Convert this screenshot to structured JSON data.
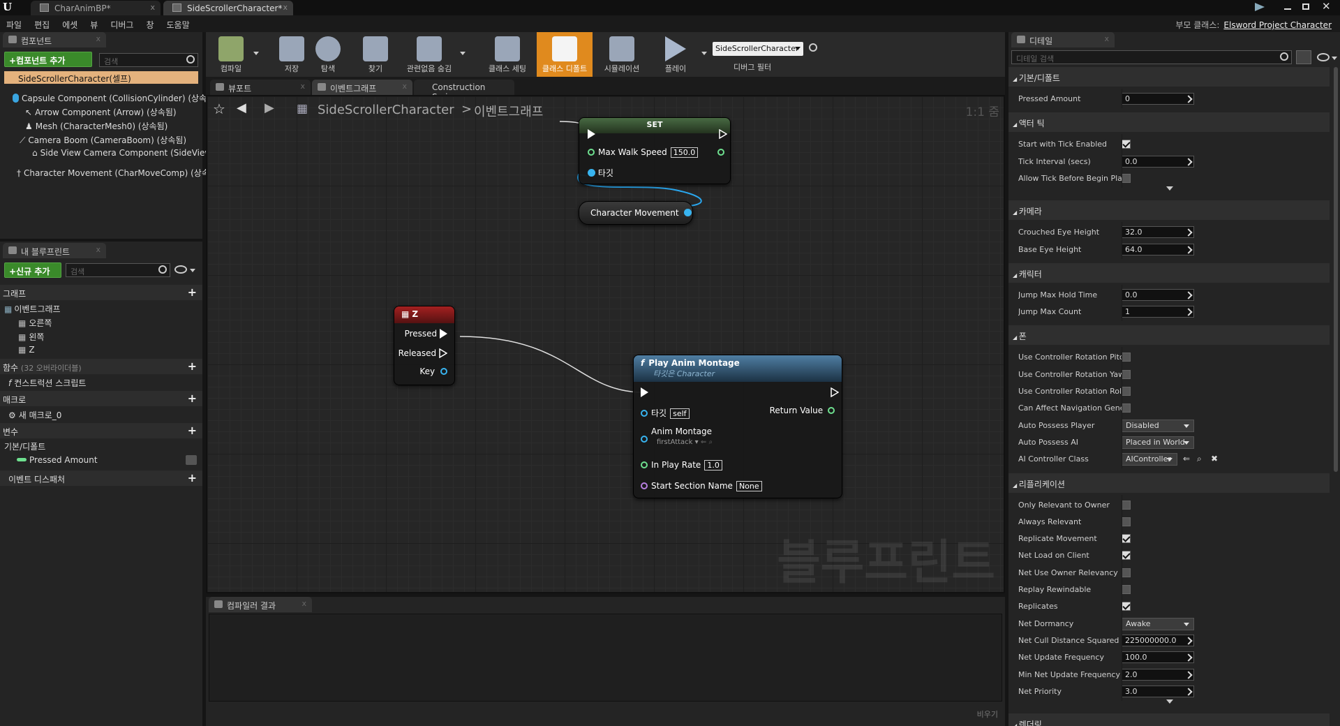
{
  "tabs": [
    {
      "label": "CharAnimBP*",
      "close": "x"
    },
    {
      "label": "SideScrollerCharacter*",
      "close": "x"
    }
  ],
  "menu": [
    "파일",
    "편집",
    "에셋",
    "뷰",
    "디버그",
    "창",
    "도움말"
  ],
  "parent_class": {
    "label": "부모 클래스:",
    "value": "Elsword Project Character"
  },
  "components": {
    "tab": "컴포넌트",
    "add_button": "+컴포넌트 추가",
    "search_placeholder": "검색",
    "root": "SideScrollerCharacter(셀프)",
    "items": [
      "Capsule Component (CollisionCylinder) (상속",
      "Arrow Component (Arrow) (상속됨)",
      "Mesh (CharacterMesh0) (상속됨)",
      "Camera Boom (CameraBoom) (상속됨)",
      "Side View Camera Component (SideView",
      "Character Movement (CharMoveComp) (상속"
    ]
  },
  "myblueprint": {
    "tab": "내 블루프린트",
    "add_button": "+신규 추가",
    "search_placeholder": "검색",
    "graph_section": "그래프",
    "eventgraph": "이벤트그래프",
    "events": [
      "오른쪽",
      "왼쪽",
      "Z"
    ],
    "functions_section": "함수",
    "functions_note": "(32 오버라이더블)",
    "construction_script": "컨스트럭션 스크립트",
    "macros_section": "매크로",
    "macro_item": "새 매크로_0",
    "variables_section": "변수",
    "default_section": "기본/디폴트",
    "pressed_amount": "Pressed Amount",
    "dispatcher_section": "이벤트 디스패처"
  },
  "toolbar": {
    "compile": "컴파일",
    "save": "저장",
    "browse": "탐색",
    "find": "찾기",
    "hide_unrelated": "관련없음 숨김",
    "class_settings": "클래스 세팅",
    "class_defaults": "클래스 디폴트",
    "simulation": "시뮬레이션",
    "play": "플레이",
    "debug_object": "SideScrollerCharacter",
    "debug_filter": "디버그 필터"
  },
  "editor_tabs": [
    {
      "label": "뷰포트"
    },
    {
      "label": "이벤트그래프"
    },
    {
      "label": "Construction Scrip"
    }
  ],
  "breadcrumb": {
    "root": "SideScrollerCharacter",
    "sep": ">",
    "graph": "이벤트그래프",
    "zoom": "1:1 줌"
  },
  "nodes": {
    "set": {
      "title": "SET",
      "pin_speed": "Max Walk Speed",
      "speed_value": "150.0",
      "pin_target": "타깃"
    },
    "char_movement": {
      "label": "Character Movement"
    },
    "z": {
      "title": "Z",
      "pressed": "Pressed",
      "released": "Released",
      "key": "Key"
    },
    "montage": {
      "title": "Play Anim Montage",
      "subtitle": "타깃은 Character",
      "target": "타깃",
      "target_value": "self",
      "return": "Return Value",
      "anim_montage": "Anim Montage",
      "anim_value": "firstAttack",
      "play_rate": "In Play Rate",
      "play_rate_value": "1.0",
      "start_section": "Start Section Name",
      "start_section_value": "None"
    }
  },
  "watermark": "블루프린트",
  "compiler": {
    "tab": "컴파일러 결과",
    "clear": "비우기"
  },
  "details": {
    "tab": "디테일",
    "search_placeholder": "디테일 검색",
    "sections": [
      {
        "title": "기본/디폴트",
        "rows": [
          {
            "label": "Pressed Amount",
            "kind": "num",
            "value": "0"
          }
        ]
      },
      {
        "title": "액터 틱",
        "rows": [
          {
            "label": "Start with Tick Enabled",
            "kind": "chk",
            "value": true
          },
          {
            "label": "Tick Interval (secs)",
            "kind": "num",
            "value": "0.0"
          },
          {
            "label": "Allow Tick Before Begin Play",
            "kind": "chk",
            "value": false
          }
        ],
        "more": true
      },
      {
        "title": "카메라",
        "rows": [
          {
            "label": "Crouched Eye Height",
            "kind": "num",
            "value": "32.0"
          },
          {
            "label": "Base Eye Height",
            "kind": "num",
            "value": "64.0"
          }
        ]
      },
      {
        "title": "캐릭터",
        "rows": [
          {
            "label": "Jump Max Hold Time",
            "kind": "num",
            "value": "0.0"
          },
          {
            "label": "Jump Max Count",
            "kind": "num",
            "value": "1"
          }
        ]
      },
      {
        "title": "폰",
        "rows": [
          {
            "label": "Use Controller Rotation Pitch",
            "kind": "chk",
            "value": false
          },
          {
            "label": "Use Controller Rotation Yaw",
            "kind": "chk",
            "value": false
          },
          {
            "label": "Use Controller Rotation Roll",
            "kind": "chk",
            "value": false
          },
          {
            "label": "Can Affect Navigation Genera",
            "kind": "chk",
            "value": false
          },
          {
            "label": "Auto Possess Player",
            "kind": "combo",
            "value": "Disabled"
          },
          {
            "label": "Auto Possess AI",
            "kind": "combo",
            "value": "Placed in World"
          },
          {
            "label": "AI Controller Class",
            "kind": "combo",
            "value": "AIController"
          }
        ]
      },
      {
        "title": "리플리케이션",
        "rows": [
          {
            "label": "Only Relevant to Owner",
            "kind": "chk",
            "value": false
          },
          {
            "label": "Always Relevant",
            "kind": "chk",
            "value": false
          },
          {
            "label": "Replicate Movement",
            "kind": "chk",
            "value": true
          },
          {
            "label": "Net Load on Client",
            "kind": "chk",
            "value": true
          },
          {
            "label": "Net Use Owner Relevancy",
            "kind": "chk",
            "value": false
          },
          {
            "label": "Replay Rewindable",
            "kind": "chk",
            "value": false
          },
          {
            "label": "Replicates",
            "kind": "chk",
            "value": true
          },
          {
            "label": "Net Dormancy",
            "kind": "combo",
            "value": "Awake"
          },
          {
            "label": "Net Cull Distance Squared",
            "kind": "num",
            "value": "225000000.0"
          },
          {
            "label": "Net Update Frequency",
            "kind": "num",
            "value": "100.0"
          },
          {
            "label": "Min Net Update Frequency",
            "kind": "num",
            "value": "2.0"
          },
          {
            "label": "Net Priority",
            "kind": "num",
            "value": "3.0"
          }
        ],
        "more": true
      },
      {
        "title": "렌더링",
        "rows": []
      }
    ]
  }
}
